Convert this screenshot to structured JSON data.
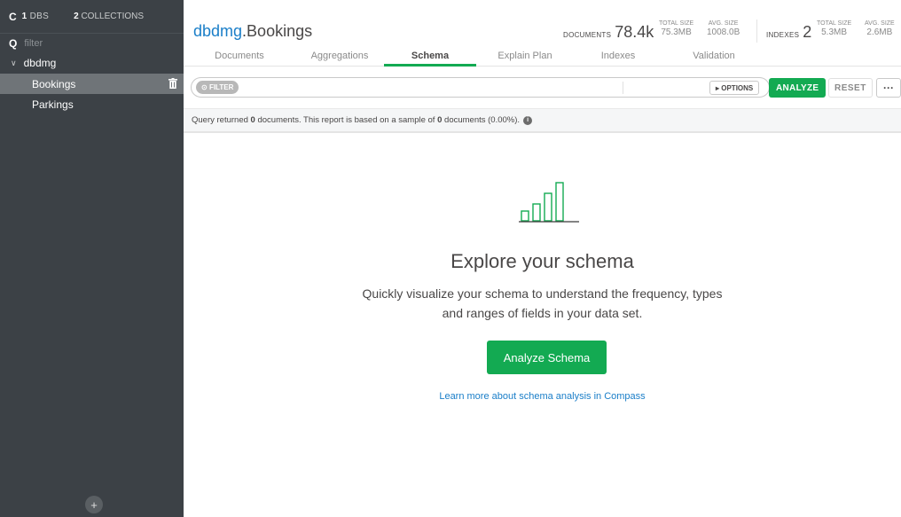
{
  "sidebar": {
    "dbs_count": "1",
    "dbs_label": "DBS",
    "collections_count": "2",
    "collections_label": "COLLECTIONS",
    "filter_placeholder": "filter",
    "database": "dbdmg",
    "collections": [
      "Bookings",
      "Parkings"
    ],
    "active_collection": "Bookings",
    "add_label": "+"
  },
  "header": {
    "db_name": "dbdmg",
    "collection_name": ".Bookings",
    "documents_label": "DOCUMENTS",
    "documents_count": "78.4k",
    "docs_total_size_label": "TOTAL SIZE",
    "docs_total_size": "75.3MB",
    "docs_avg_size_label": "AVG. SIZE",
    "docs_avg_size": "1008.0B",
    "indexes_label": "INDEXES",
    "indexes_count": "2",
    "idx_total_size_label": "TOTAL SIZE",
    "idx_total_size": "5.3MB",
    "idx_avg_size_label": "AVG. SIZE",
    "idx_avg_size": "2.6MB"
  },
  "tabs": [
    {
      "label": "Documents",
      "active": false
    },
    {
      "label": "Aggregations",
      "active": false
    },
    {
      "label": "Schema",
      "active": true
    },
    {
      "label": "Explain Plan",
      "active": false
    },
    {
      "label": "Indexes",
      "active": false
    },
    {
      "label": "Validation",
      "active": false
    }
  ],
  "query_bar": {
    "filter_pill": "FILTER",
    "options_label": "OPTIONS",
    "analyze_label": "ANALYZE",
    "reset_label": "RESET",
    "more_label": "···"
  },
  "info": {
    "prefix": "Query returned ",
    "returned": "0",
    "middle": " documents. This report is based on a sample of ",
    "sampled": "0",
    "suffix": " documents (0.00%)."
  },
  "main": {
    "heading": "Explore your schema",
    "desc_line1": "Quickly visualize your schema to understand the frequency, types",
    "desc_line2": "and ranges of fields in your data set.",
    "button": "Analyze Schema",
    "learn_link": "Learn more about schema analysis in Compass"
  },
  "colors": {
    "accent_green": "#13aa52",
    "link_blue": "#1a7ec8",
    "sidebar_bg": "#3c4146"
  }
}
